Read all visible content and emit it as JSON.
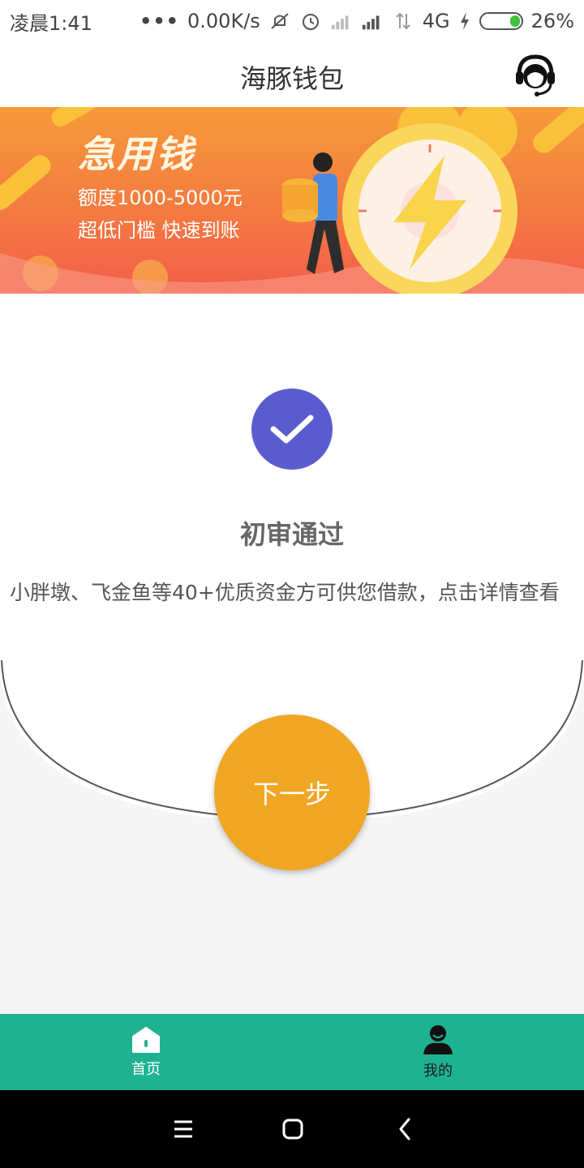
{
  "status_bar": {
    "time": "凌晨1:41",
    "dots": "•••",
    "net_speed": "0.00K/s",
    "network": "4G",
    "battery": "26%"
  },
  "header": {
    "title": "海豚钱包",
    "support_icon": "customer-service-icon"
  },
  "banner": {
    "title": "急用钱",
    "line1": "额度1000-5000元",
    "line2": "超低门槛 快速到账"
  },
  "result": {
    "icon": "check-icon",
    "title": "初审通过",
    "description": "小胖墩、飞金鱼等40+优质资金方可供您借款，点击详情查看"
  },
  "next_button": {
    "label": "下一步"
  },
  "tabs": [
    {
      "label": "首页",
      "icon": "home-icon",
      "active": true
    },
    {
      "label": "我的",
      "icon": "user-icon",
      "active": false
    }
  ],
  "colors": {
    "accent": "#f0a623",
    "check": "#5b5bd0",
    "tab_bar": "#1fb291"
  }
}
